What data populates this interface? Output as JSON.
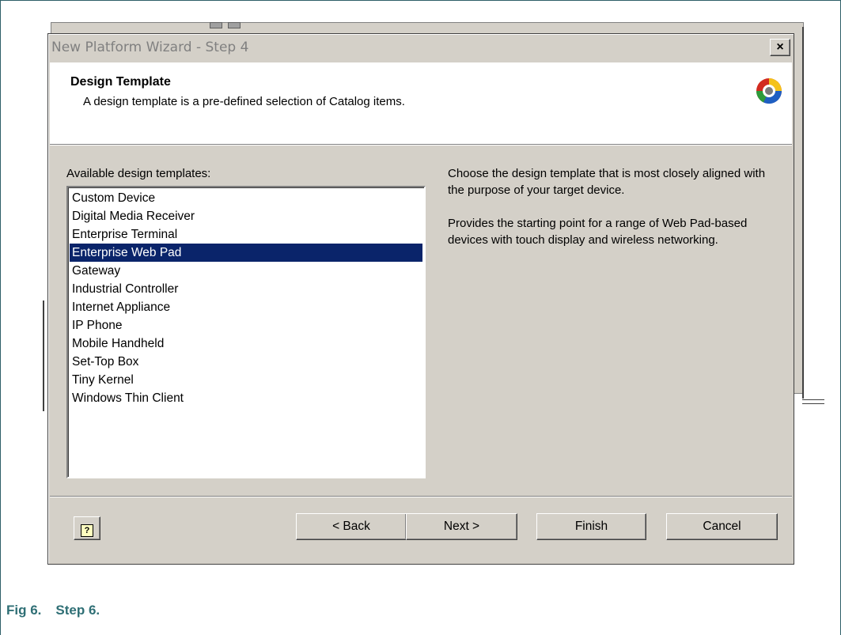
{
  "dialog": {
    "title": "New Platform Wizard - Step 4",
    "close_label": "×",
    "header": {
      "title": "Design Template",
      "description": "A design template is a pre-defined selection of Catalog items."
    },
    "list_label": "Available design templates:",
    "templates": [
      "Custom Device",
      "Digital Media Receiver",
      "Enterprise Terminal",
      "Enterprise Web Pad",
      "Gateway",
      "Industrial Controller",
      "Internet Appliance",
      "IP Phone",
      "Mobile Handheld",
      "Set-Top Box",
      "Tiny Kernel",
      "Windows Thin Client"
    ],
    "selected_template": "Enterprise Web Pad",
    "description_1": "Choose the design template that is most closely aligned with the purpose of your target device.",
    "description_2": "Provides the starting point for a range of Web Pad-based devices with touch display and wireless networking.",
    "buttons": {
      "help_icon": "help-icon",
      "help_glyph": "?",
      "back": "< Back",
      "next": "Next >",
      "finish": "Finish",
      "cancel": "Cancel"
    }
  },
  "caption": {
    "number": "Fig 6.",
    "text": "Step 6."
  },
  "colors": {
    "selection": "#0a246a",
    "dialog_bg": "#d4d0c8",
    "caption": "#2f6f75"
  }
}
